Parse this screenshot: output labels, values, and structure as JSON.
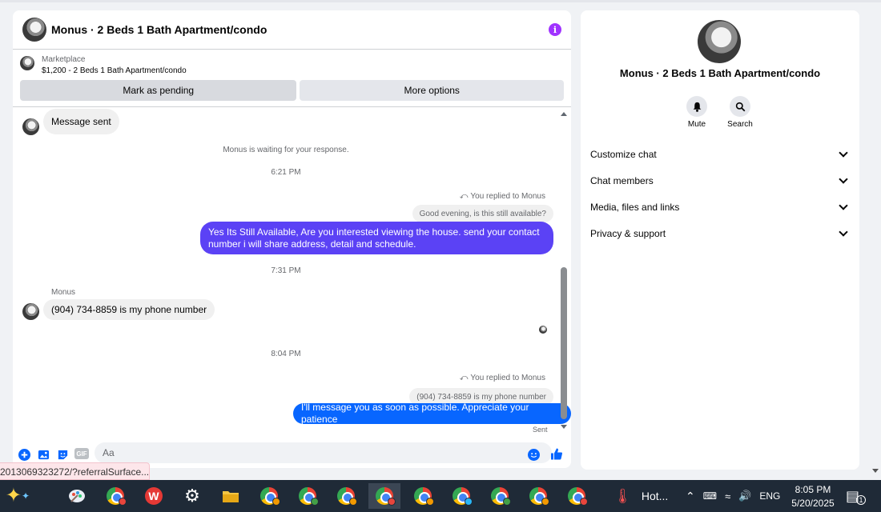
{
  "header": {
    "title": "Monus · 2 Beds 1 Bath Apartment/condo",
    "info_icon": "info-icon",
    "accent": "#a033ff"
  },
  "listing": {
    "label": "Marketplace",
    "subtitle": "$1,200 - 2 Beds 1 Bath Apartment/condo",
    "pending_label": "Mark as pending",
    "more_label": "More options"
  },
  "messages": {
    "msg1": "Message sent",
    "waiting": "Monus is waiting for your response.",
    "time1": "6:21 PM",
    "reply1_tag": "You replied to Monus",
    "reply1_quote": "Good evening, is this still available?",
    "reply1_text": "Yes Its Still Available, Are you interested viewing the house. send your contact number i will share address, detail and schedule.",
    "time2": "7:31 PM",
    "sender_name": "Monus",
    "msg2": "(904) 734-8859 is my phone number",
    "time3": "8:04 PM",
    "reply2_tag": "You replied to Monus",
    "reply2_quote": "(904) 734-8859 is my phone number",
    "reply2_text": "I'll message you as soon as possible. Appreciate your patience",
    "status": "Sent"
  },
  "composer": {
    "placeholder": "Aa",
    "gif_label": "GIF"
  },
  "status_tooltip": "2013069323272/?referralSurface...",
  "info_panel": {
    "title": "Monus · 2 Beds 1 Bath Apartment/condo",
    "mute_label": "Mute",
    "search_label": "Search",
    "sections": [
      "Customize chat",
      "Chat members",
      "Media, files and links",
      "Privacy & support"
    ]
  },
  "taskbar": {
    "weather": "Hot...",
    "language": "ENG",
    "time": "8:05 PM",
    "date": "5/20/2025",
    "notification_count": "1"
  },
  "colors": {
    "outgoing_blue": "#0866ff",
    "outgoing_purple": "#5b42f5",
    "taskbar": "#1f2a37"
  }
}
